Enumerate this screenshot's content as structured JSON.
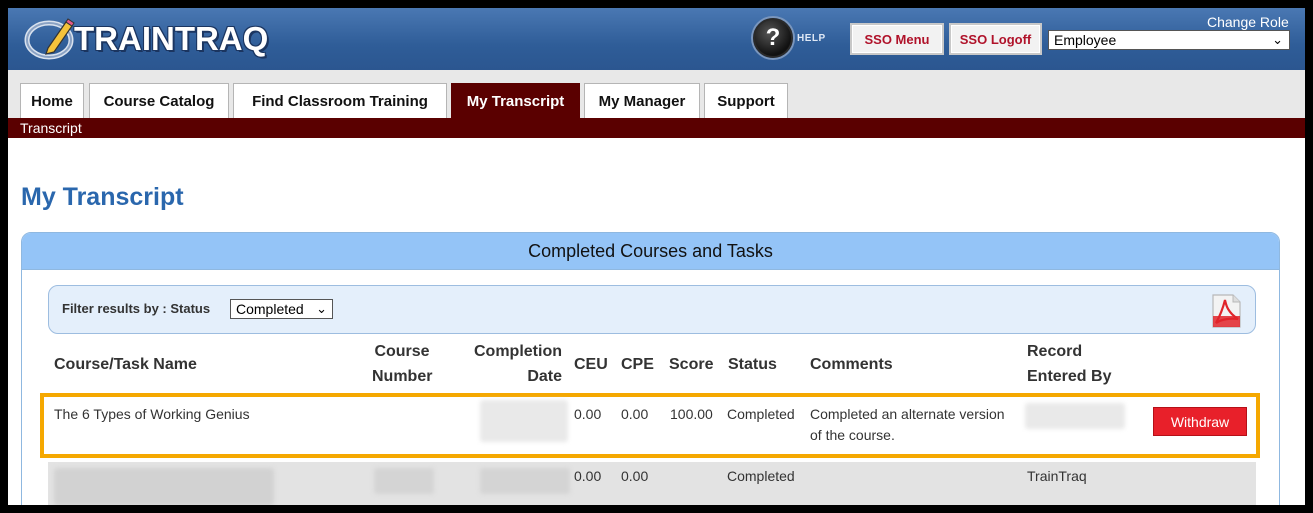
{
  "header": {
    "app_name": "TRAINTRAQ",
    "help_label": "HELP",
    "sso_menu": "SSO Menu",
    "sso_logoff": "SSO Logoff",
    "change_role": "Change Role",
    "role_value": "Employee"
  },
  "tabs": [
    {
      "label": "Home"
    },
    {
      "label": "Course Catalog"
    },
    {
      "label": "Find Classroom Training"
    },
    {
      "label": "My Transcript",
      "active": true
    },
    {
      "label": "My Manager"
    },
    {
      "label": "Support"
    }
  ],
  "breadcrumb": "Transcript",
  "page_title": "My Transcript",
  "panel": {
    "title": "Completed Courses and Tasks",
    "filter_label": "Filter results by :  Status",
    "filter_value": "Completed"
  },
  "columns": {
    "name": "Course/Task Name",
    "number_1": "Course",
    "number_2": "Number",
    "date_1": "Completion",
    "date_2": "Date",
    "ceu": "CEU",
    "cpe": "CPE",
    "score": "Score",
    "status": "Status",
    "comments": "Comments",
    "record_1": "Record",
    "record_2": "Entered By"
  },
  "rows": [
    {
      "name": "The 6 Types of Working Genius",
      "ceu": "0.00",
      "cpe": "0.00",
      "score": "100.00",
      "status": "Completed",
      "comments_1": "Completed an alternate version",
      "comments_2": "of the course.",
      "action": "Withdraw"
    },
    {
      "ceu": "0.00",
      "cpe": "0.00",
      "status": "Completed",
      "entered_by": "TrainTraq"
    }
  ],
  "colors": {
    "header_blue": "#2f5d98",
    "maroon": "#5a0000",
    "title_blue": "#2a67ad",
    "panel_blue": "#94c4f7",
    "highlight": "#f5a800",
    "withdraw_red": "#e8202a"
  }
}
